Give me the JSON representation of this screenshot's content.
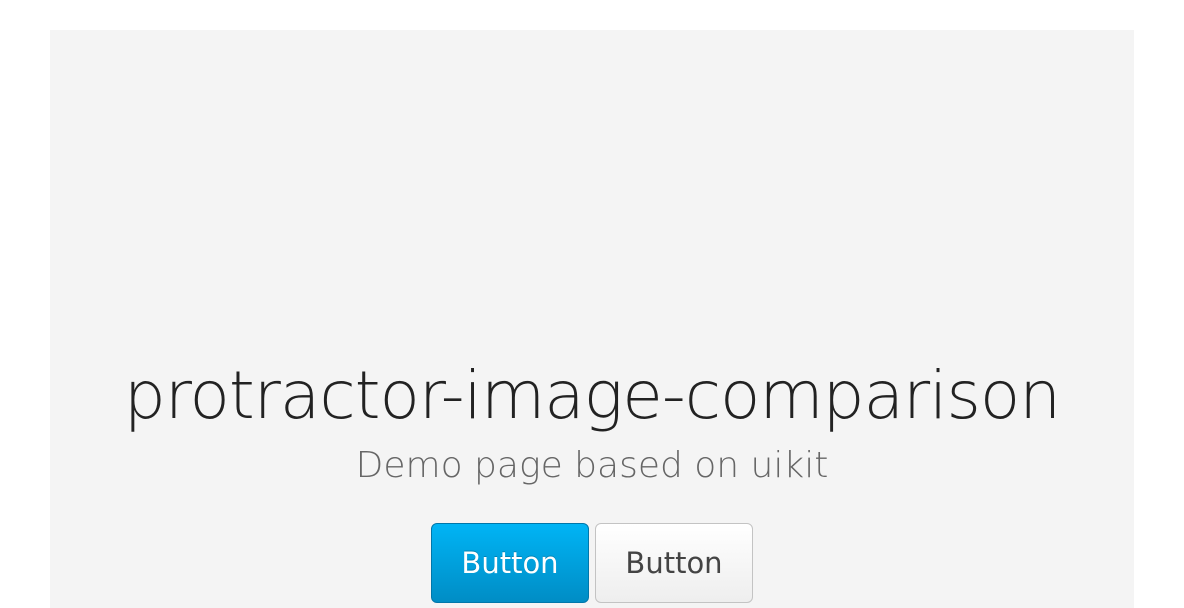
{
  "hero": {
    "title": "protractor-image-comparison",
    "subtitle": "Demo page based on uikit"
  },
  "buttons": {
    "primary_label": "Button",
    "default_label": "Button"
  },
  "colors": {
    "hero_background": "#f4f4f4",
    "primary_button": "#00a8e6",
    "title_text": "#222222",
    "subtitle_text": "#666666"
  }
}
